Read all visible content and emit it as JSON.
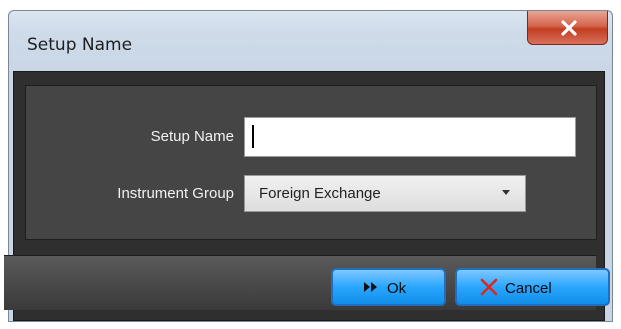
{
  "window": {
    "title": "Setup Name"
  },
  "form": {
    "setup_name_label": "Setup Name",
    "setup_name_value": "",
    "instrument_group_label": "Instrument Group",
    "instrument_group_value": "Foreign Exchange"
  },
  "buttons": {
    "ok_label": "Ok",
    "cancel_label": "Cancel"
  },
  "icons": {
    "close": "close-icon",
    "ok": "fast-forward-icon",
    "cancel": "x-icon",
    "dropdown": "chevron-down-icon"
  },
  "colors": {
    "close_button": "#c9482d",
    "button_accent": "#2aa6ff",
    "cancel_icon": "#e0261c",
    "dialog_background": "#454545"
  }
}
